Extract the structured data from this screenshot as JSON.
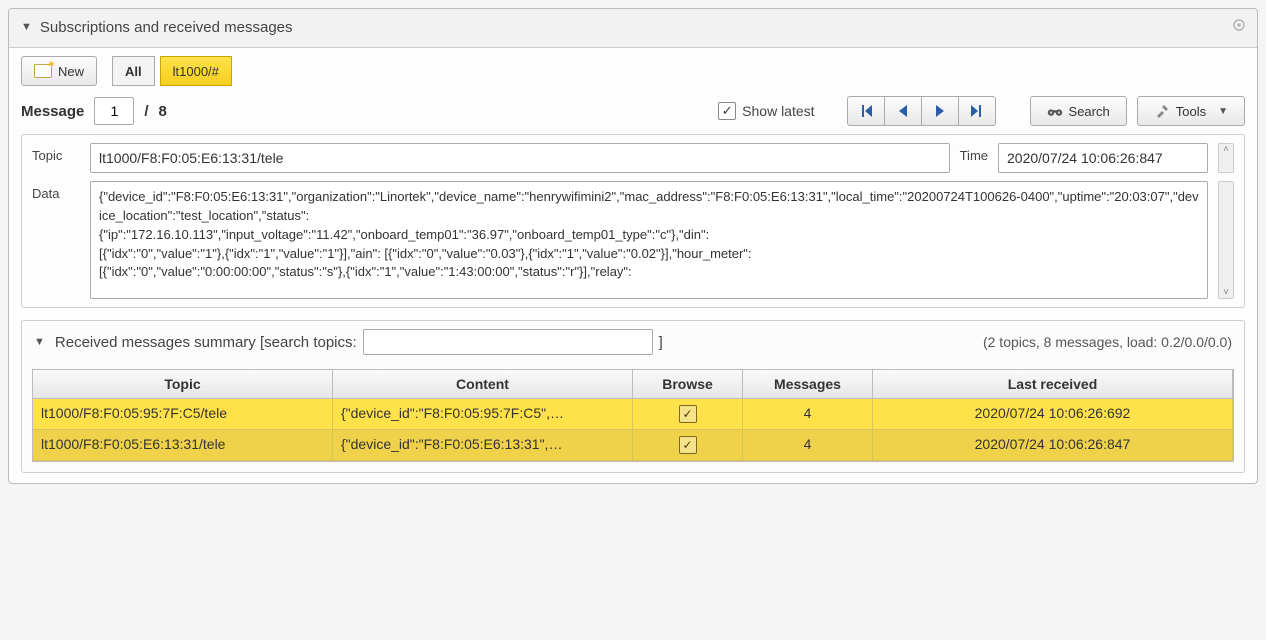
{
  "panel": {
    "title": "Subscriptions and received messages",
    "gear_icon": "settings"
  },
  "toolbar": {
    "new_label": "New",
    "tabs": [
      "All",
      "lt1000/#"
    ],
    "active_tab_index": 0
  },
  "nav": {
    "message_label": "Message",
    "current": "1",
    "separator": "/",
    "total": "8",
    "show_latest_label": "Show latest",
    "show_latest_checked": true,
    "search_label": "Search",
    "tools_label": "Tools"
  },
  "message": {
    "topic_label": "Topic",
    "topic_value": "lt1000/F8:F0:05:E6:13:31/tele",
    "time_label": "Time",
    "time_value": "2020/07/24 10:06:26:847",
    "data_label": "Data",
    "data_value": "{\"device_id\":\"F8:F0:05:E6:13:31\",\"organization\":\"Linortek\",\"device_name\":\"henrywifimini2\",\"mac_address\":\"F8:F0:05:E6:13:31\",\"local_time\":\"20200724T100626-0400\",\"uptime\":\"20:03:07\",\"device_location\":\"test_location\",\"status\":\n{\"ip\":\"172.16.10.113\",\"input_voltage\":\"11.42\",\"onboard_temp01\":\"36.97\",\"onboard_temp01_type\":\"c\"},\"din\":\n[{\"idx\":\"0\",\"value\":\"1\"},{\"idx\":\"1\",\"value\":\"1\"}],\"ain\": [{\"idx\":\"0\",\"value\":\"0.03\"},{\"idx\":\"1\",\"value\":\"0.02\"}],\"hour_meter\":\n[{\"idx\":\"0\",\"value\":\"0:00:00:00\",\"status\":\"s\"},{\"idx\":\"1\",\"value\":\"1:43:00:00\",\"status\":\"r\"}],\"relay\":"
  },
  "summary": {
    "header_prefix": "Received messages summary [search topics:",
    "header_suffix": "]",
    "stats": "(2 topics, 8 messages, load: 0.2/0.0/0.0)",
    "columns": [
      "Topic",
      "Content",
      "Browse",
      "Messages",
      "Last received"
    ],
    "rows": [
      {
        "topic": "lt1000/F8:F0:05:95:7F:C5/tele",
        "content": "{\"device_id\":\"F8:F0:05:95:7F:C5\",…",
        "browse": true,
        "messages": "4",
        "last": "2020/07/24 10:06:26:692"
      },
      {
        "topic": "lt1000/F8:F0:05:E6:13:31/tele",
        "content": "{\"device_id\":\"F8:F0:05:E6:13:31\",…",
        "browse": true,
        "messages": "4",
        "last": "2020/07/24 10:06:26:847"
      }
    ]
  }
}
